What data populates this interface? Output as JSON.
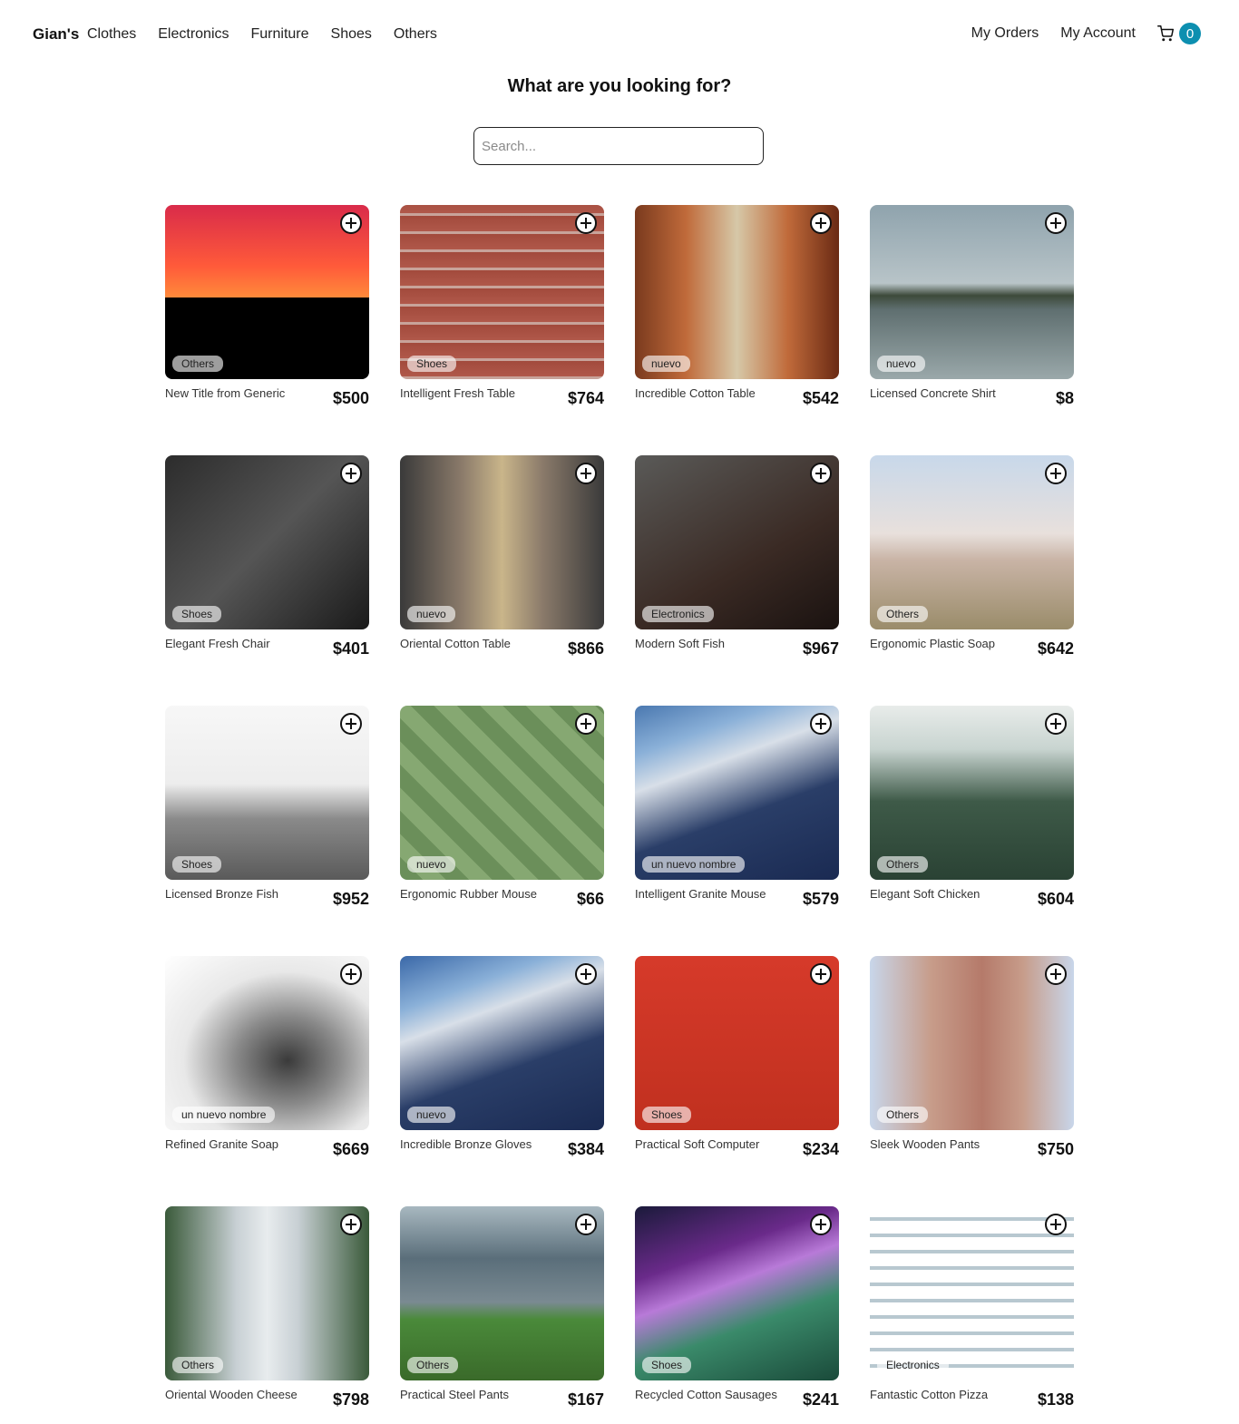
{
  "nav": {
    "brand": "Gian's",
    "categories": [
      "Clothes",
      "Electronics",
      "Furniture",
      "Shoes",
      "Others"
    ],
    "my_orders": "My Orders",
    "my_account": "My Account",
    "cart_count": "0"
  },
  "hero": {
    "title": "What are you looking for?",
    "search_placeholder": "Search..."
  },
  "products": [
    {
      "name": "New Title from Generic",
      "price": "$500",
      "category": "Others"
    },
    {
      "name": "Intelligent Fresh Table",
      "price": "$764",
      "category": "Shoes"
    },
    {
      "name": "Incredible Cotton Table",
      "price": "$542",
      "category": "nuevo"
    },
    {
      "name": "Licensed Concrete Shirt",
      "price": "$8",
      "category": "nuevo"
    },
    {
      "name": "Elegant Fresh Chair",
      "price": "$401",
      "category": "Shoes"
    },
    {
      "name": "Oriental Cotton Table",
      "price": "$866",
      "category": "nuevo"
    },
    {
      "name": "Modern Soft Fish",
      "price": "$967",
      "category": "Electronics"
    },
    {
      "name": "Ergonomic Plastic Soap",
      "price": "$642",
      "category": "Others"
    },
    {
      "name": "Licensed Bronze Fish",
      "price": "$952",
      "category": "Shoes"
    },
    {
      "name": "Ergonomic Rubber Mouse",
      "price": "$66",
      "category": "nuevo"
    },
    {
      "name": "Intelligent Granite Mouse",
      "price": "$579",
      "category": "un nuevo nombre"
    },
    {
      "name": "Elegant Soft Chicken",
      "price": "$604",
      "category": "Others"
    },
    {
      "name": "Refined Granite Soap",
      "price": "$669",
      "category": "un nuevo nombre"
    },
    {
      "name": "Incredible Bronze Gloves",
      "price": "$384",
      "category": "nuevo"
    },
    {
      "name": "Practical Soft Computer",
      "price": "$234",
      "category": "Shoes"
    },
    {
      "name": "Sleek Wooden Pants",
      "price": "$750",
      "category": "Others"
    },
    {
      "name": "Oriental Wooden Cheese",
      "price": "$798",
      "category": "Others"
    },
    {
      "name": "Practical Steel Pants",
      "price": "$167",
      "category": "Others"
    },
    {
      "name": "Recycled Cotton Sausages",
      "price": "$241",
      "category": "Shoes"
    },
    {
      "name": "Fantastic Cotton Pizza",
      "price": "$138",
      "category": "Electronics"
    }
  ],
  "colors": {
    "cart_badge": "#0d8fb0"
  }
}
